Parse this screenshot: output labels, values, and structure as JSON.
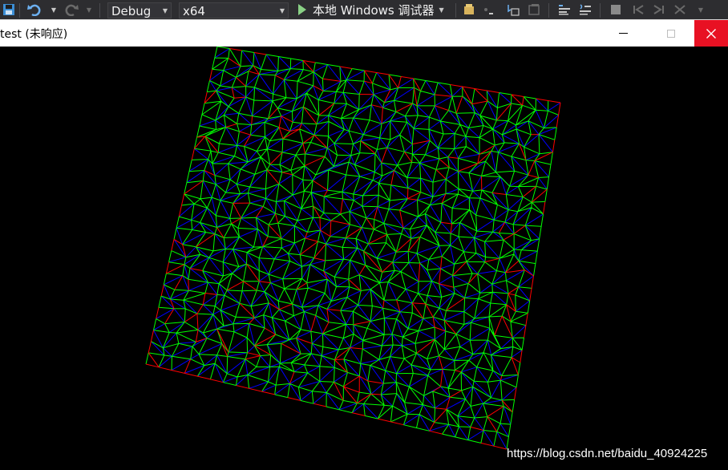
{
  "toolbar": {
    "configuration": "Debug",
    "platform": "x64",
    "run_label": "本地 Windows 调试器",
    "icons": [
      "save-icon",
      "undo-icon",
      "redo-icon",
      "start-debug-icon",
      "find-icon",
      "step-icon",
      "bookmark-icon",
      "comment-icon",
      "uncomment-icon",
      "breakpoint-icon",
      "nav-back-icon",
      "nav-forward-icon",
      "clear-icon"
    ]
  },
  "window": {
    "title": "test (未响应)",
    "controls": [
      "minimize",
      "maximize",
      "close"
    ]
  },
  "render": {
    "description_colors": {
      "background": "#000000",
      "internal_edges": "#00ff00",
      "boundary_edges": "#ff0000",
      "diagonal_edges": "#0000ff"
    }
  },
  "watermark": "https://blog.csdn.net/baidu_40924225"
}
